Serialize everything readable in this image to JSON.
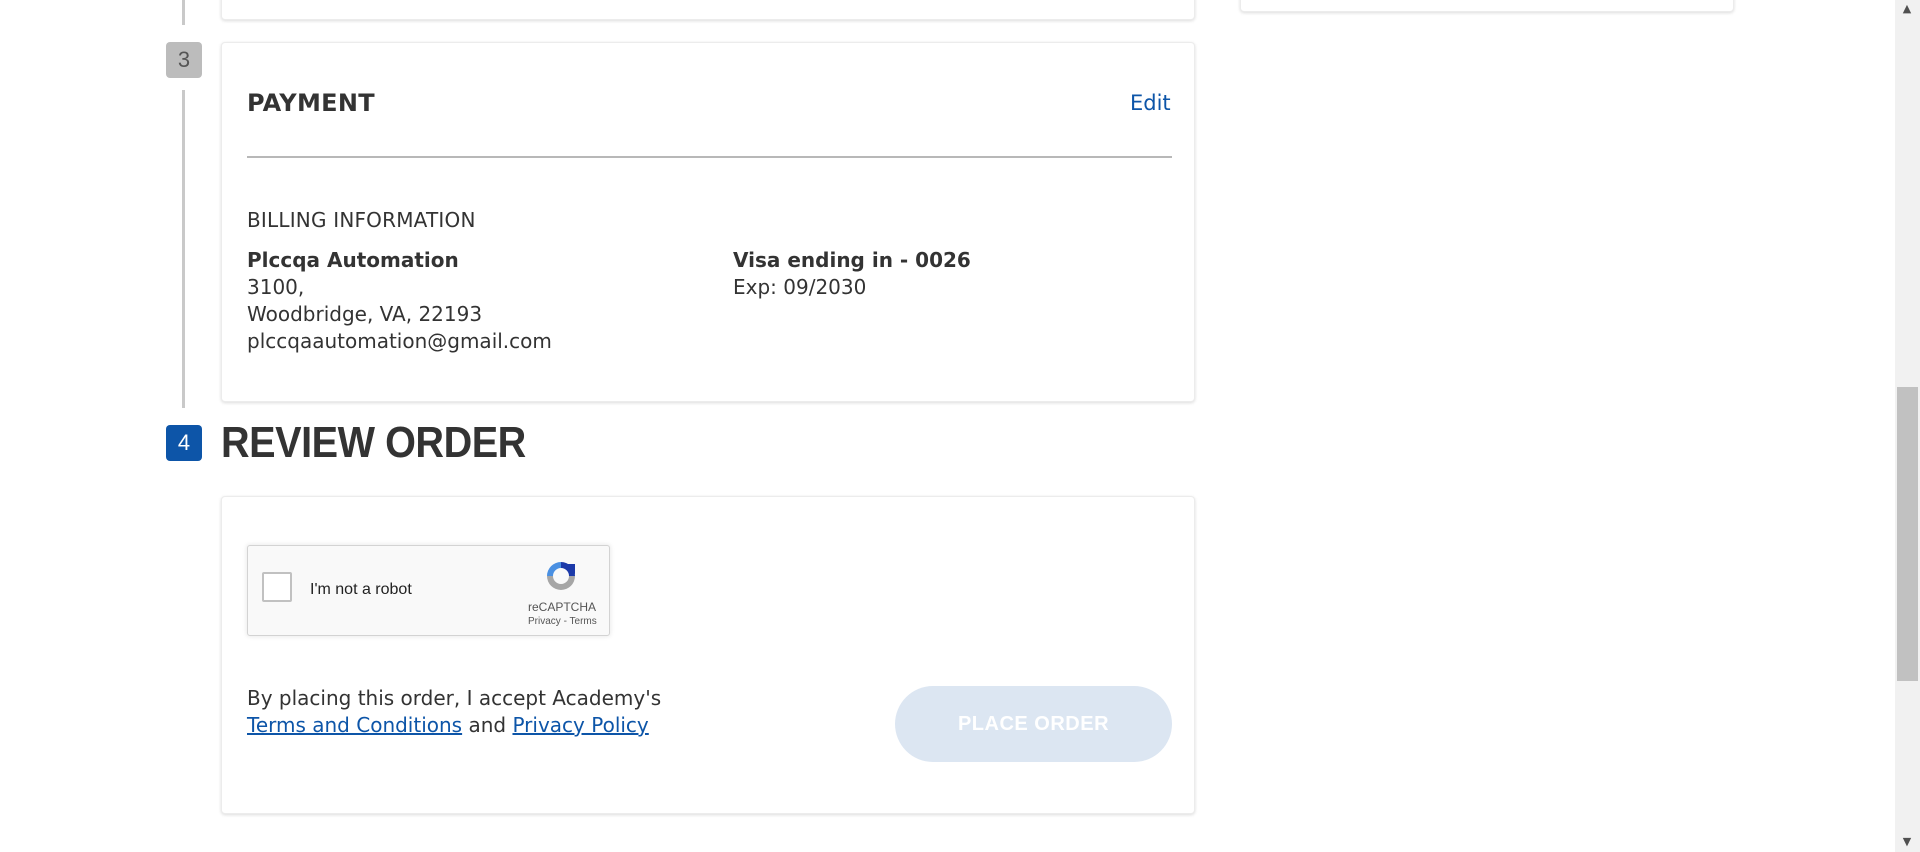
{
  "steps": {
    "payment_number": "3",
    "review_number": "4"
  },
  "payment": {
    "title": "PAYMENT",
    "edit_label": "Edit",
    "billing_heading": "BILLING INFORMATION",
    "name": "Plccqa Automation",
    "address_line1": "3100,",
    "address_line2": "Woodbridge, VA, 22193",
    "email": "plccqaautomation@gmail.com",
    "card_label": "Visa ending in - 0026",
    "card_exp": "Exp: 09/2030"
  },
  "review": {
    "title": "REVIEW ORDER",
    "recaptcha": {
      "label": "I'm not a robot",
      "brand": "reCAPTCHA",
      "privacy": "Privacy",
      "separator": " - ",
      "terms": "Terms"
    },
    "consent_text": "By placing this order, I accept Academy's",
    "terms_link": "Terms and Conditions",
    "and_text": "and",
    "privacy_link": "Privacy Policy",
    "place_order_label": "PLACE ORDER"
  },
  "colors": {
    "brand_blue": "#0d55a8",
    "disabled_button": "#dce6f2",
    "completed_step": "#bcbcbc"
  },
  "icons": {
    "recaptcha": "recaptcha-logo-icon",
    "scroll_up": "chevron-up-icon",
    "scroll_down": "chevron-down-icon"
  }
}
